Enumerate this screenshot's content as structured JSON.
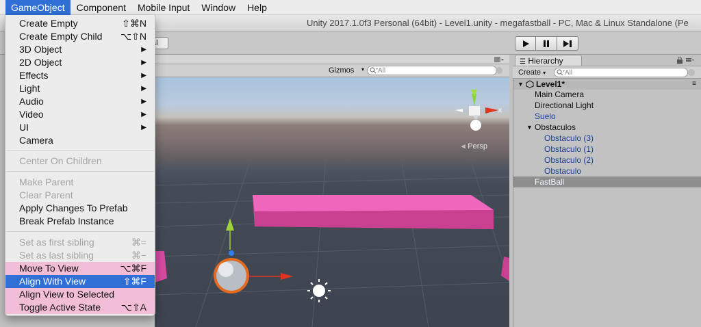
{
  "menubar": {
    "items": [
      "GameObject",
      "Component",
      "Mobile Input",
      "Window",
      "Help"
    ],
    "active_index": 0
  },
  "window": {
    "title": "Unity 2017.1.0f3 Personal (64bit) - Level1.unity - megafastball - PC, Mac & Linux Standalone (Pe"
  },
  "toolbar": {
    "stub_label": "al",
    "play_icons": [
      "play-icon",
      "pause-icon",
      "step-icon"
    ]
  },
  "scene": {
    "gizmos_label": "Gizmos",
    "search_placeholder": "All",
    "persp_label": "Persp",
    "axis_x_label": "x"
  },
  "dropdown": {
    "items": [
      {
        "label": "Create Empty",
        "shortcut": "⇧⌘N",
        "submenu": false,
        "state": "enabled"
      },
      {
        "label": "Create Empty Child",
        "shortcut": "⌥⇧N",
        "submenu": false,
        "state": "enabled"
      },
      {
        "label": "3D Object",
        "shortcut": "",
        "submenu": true,
        "state": "enabled"
      },
      {
        "label": "2D Object",
        "shortcut": "",
        "submenu": true,
        "state": "enabled"
      },
      {
        "label": "Effects",
        "shortcut": "",
        "submenu": true,
        "state": "enabled"
      },
      {
        "label": "Light",
        "shortcut": "",
        "submenu": true,
        "state": "enabled"
      },
      {
        "label": "Audio",
        "shortcut": "",
        "submenu": true,
        "state": "enabled"
      },
      {
        "label": "Video",
        "shortcut": "",
        "submenu": true,
        "state": "enabled"
      },
      {
        "label": "UI",
        "shortcut": "",
        "submenu": true,
        "state": "enabled"
      },
      {
        "label": "Camera",
        "shortcut": "",
        "submenu": false,
        "state": "enabled"
      },
      {
        "label": "Center On Children",
        "shortcut": "",
        "submenu": false,
        "state": "disabled"
      },
      {
        "label": "Make Parent",
        "shortcut": "",
        "submenu": false,
        "state": "disabled"
      },
      {
        "label": "Clear Parent",
        "shortcut": "",
        "submenu": false,
        "state": "disabled"
      },
      {
        "label": "Apply Changes To Prefab",
        "shortcut": "",
        "submenu": false,
        "state": "enabled"
      },
      {
        "label": "Break Prefab Instance",
        "shortcut": "",
        "submenu": false,
        "state": "enabled"
      },
      {
        "label": "Set as first sibling",
        "shortcut": "⌘=",
        "submenu": false,
        "state": "disabled"
      },
      {
        "label": "Set as last sibling",
        "shortcut": "⌘−",
        "submenu": false,
        "state": "disabled"
      },
      {
        "label": "Move To View",
        "shortcut": "⌥⌘F",
        "submenu": false,
        "state": "highlighted"
      },
      {
        "label": "Align With View",
        "shortcut": "⇧⌘F",
        "submenu": false,
        "state": "selected"
      },
      {
        "label": "Align View to Selected",
        "shortcut": "",
        "submenu": false,
        "state": "highlighted"
      },
      {
        "label": "Toggle Active State",
        "shortcut": "⌥⇧A",
        "submenu": false,
        "state": "highlighted"
      }
    ]
  },
  "hierarchy": {
    "tab_label": "Hierarchy",
    "create_label": "Create",
    "search_placeholder": "All",
    "scene_name": "Level1*",
    "items": [
      {
        "label": "Main Camera",
        "depth": 1,
        "kind": "normal"
      },
      {
        "label": "Directional Light",
        "depth": 1,
        "kind": "normal"
      },
      {
        "label": "Suelo",
        "depth": 1,
        "kind": "prefab"
      },
      {
        "label": "Obstaculos",
        "depth": 1,
        "kind": "normal",
        "expanded": true
      },
      {
        "label": "Obstaculo (3)",
        "depth": 2,
        "kind": "prefab"
      },
      {
        "label": "Obstaculo (1)",
        "depth": 2,
        "kind": "prefab"
      },
      {
        "label": "Obstaculo (2)",
        "depth": 2,
        "kind": "prefab"
      },
      {
        "label": "Obstaculo",
        "depth": 2,
        "kind": "prefab"
      },
      {
        "label": "FastBall",
        "depth": 1,
        "kind": "selected"
      }
    ]
  },
  "colors": {
    "menu_selected": "#2f6fd6",
    "menu_highlight": "#f2bdd7",
    "prefab_blue": "#1b3f9c",
    "box_pink": "#e44ea8",
    "gizmo_green": "#8fd13a",
    "gizmo_red": "#e2341d"
  }
}
